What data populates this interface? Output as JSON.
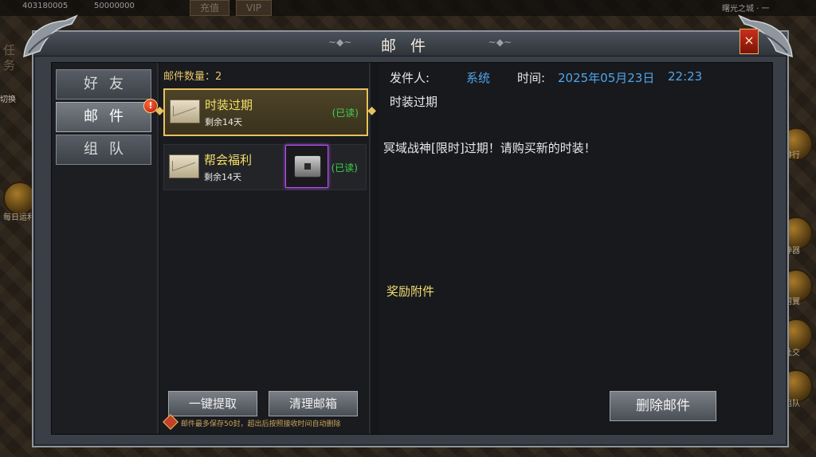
{
  "hud": {
    "stat_a": "403180005",
    "stat_b": "50000000",
    "recharge": "充值",
    "vip": "VIP",
    "task_side": "任务",
    "left_btn": "切换",
    "daily": "每日运利",
    "top_right": "曙光之城 · 一",
    "side_labels": [
      "排行",
      "神器",
      "羽翼",
      "社交",
      "组队"
    ]
  },
  "window": {
    "title": "邮件",
    "close_label": "×"
  },
  "tabs": [
    {
      "label": "好友",
      "active": false
    },
    {
      "label": "邮件",
      "active": true
    },
    {
      "label": "组队",
      "active": false
    }
  ],
  "mail_list": {
    "count_label": "邮件数量：2",
    "items": [
      {
        "title": "时装过期",
        "remain": "剩余14天",
        "status": "(已读)",
        "selected": true,
        "has_attachment": false
      },
      {
        "title": "帮会福利",
        "remain": "剩余14天",
        "status": "(已读)",
        "selected": false,
        "has_attachment": true,
        "attachment_icon": "chest-icon"
      }
    ],
    "collect_all": "一键提取",
    "clear_mailbox": "清理邮箱",
    "note": "邮件最多保存50封，超出后按照接收时间自动删除"
  },
  "detail": {
    "sender_label": "发件人:",
    "sender": "系统",
    "time_label": "时间:",
    "date": "2025年05月23日",
    "clock": "22:23",
    "subject": "时装过期",
    "body": "冥域战神[限时]过期！请购买新的时装！",
    "reward_label": "奖励附件",
    "delete": "删除邮件"
  },
  "colors": {
    "gold_text": "#f3e066",
    "read_green": "#3fd34d",
    "info_blue": "#4fa5e8",
    "selected_border": "#e8c25c",
    "attachment_border": "#b44ff0"
  }
}
